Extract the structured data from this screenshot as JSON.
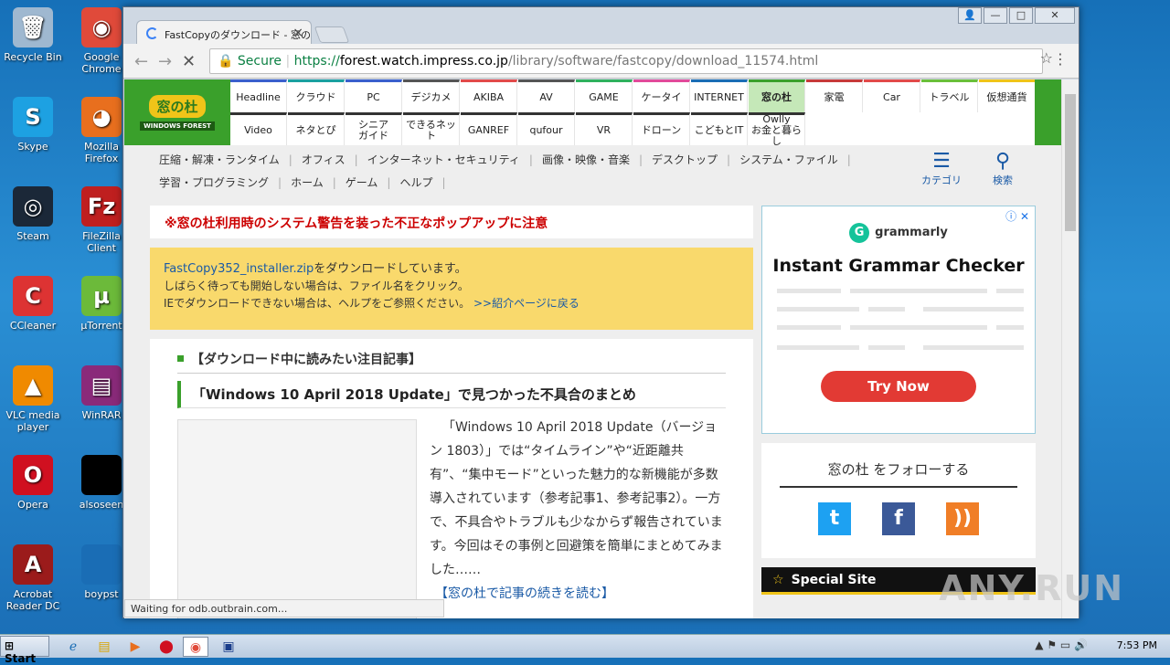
{
  "desktop": {
    "icons": [
      {
        "label": "Recycle Bin",
        "glyph": "🗑",
        "color": "#9fb8d0"
      },
      {
        "label": "Google Chrome",
        "glyph": "◉",
        "color": "#e04a3a"
      },
      {
        "label": "Skype",
        "glyph": "S",
        "color": "#1da1e2"
      },
      {
        "label": "Mozilla Firefox",
        "glyph": "◕",
        "color": "#e86f1e"
      },
      {
        "label": "Steam",
        "glyph": "◎",
        "color": "#1b2838"
      },
      {
        "label": "FileZilla Client",
        "glyph": "Fz",
        "color": "#bf1f1f"
      },
      {
        "label": "CCleaner",
        "glyph": "C",
        "color": "#d33"
      },
      {
        "label": "µTorrent",
        "glyph": "µ",
        "color": "#6cba3a"
      },
      {
        "label": "VLC media player",
        "glyph": "▲",
        "color": "#f08a00"
      },
      {
        "label": "WinRAR",
        "glyph": "▤",
        "color": "#8a2a7a"
      },
      {
        "label": "Opera",
        "glyph": "O",
        "color": "#d01020"
      },
      {
        "label": "alsoseen",
        "glyph": "",
        "color": "#000000"
      },
      {
        "label": "Acrobat Reader DC",
        "glyph": "A",
        "color": "#9b1b1b"
      },
      {
        "label": "boypst",
        "glyph": "",
        "color": "#1a6db5"
      }
    ]
  },
  "browser": {
    "tab_title": "FastCopyのダウンロード - 窓の",
    "url_secure": "Secure",
    "url_scheme": "https://",
    "url_domain": "forest.watch.impress.co.jp",
    "url_path": "/library/software/fastcopy/download_11574.html",
    "status": "Waiting for odb.outbrain.com..."
  },
  "site": {
    "logo_main": "窓の杜",
    "logo_sub": "WINDOWS FOREST",
    "nav_row1": [
      "Headline",
      "クラウド",
      "PC",
      "デジカメ",
      "AKIBA",
      "AV",
      "GAME",
      "ケータイ",
      "INTERNET",
      "窓の杜",
      "家電",
      "Car",
      "トラベル",
      "仮想通貨"
    ],
    "nav_row2": [
      "Video",
      "ネタとぴ",
      "シニア\nガイド",
      "できるネット",
      "GANREF",
      "qufour",
      "VR",
      "ドローン",
      "こどもとIT",
      "Owlly\nお金と暮らし"
    ],
    "nav_row1_colors": [
      "#3a5fcd",
      "#1aa0a0",
      "#3a5fcd",
      "#555555",
      "#e24a4a",
      "#555555",
      "#2fb15e",
      "#e24a9a",
      "#1a6db5",
      "#3aa02b",
      "#c73a3a",
      "#e24a4a",
      "#6abf3a",
      "#f0c419"
    ],
    "subnav_row1": [
      "圧縮・解凍・ランタイム",
      "オフィス",
      "インターネット・セキュリティ",
      "画像・映像・音楽",
      "デスクトップ",
      "システム・ファイル"
    ],
    "subnav_row2": [
      "学習・プログラミング",
      "ホーム",
      "ゲーム",
      "ヘルプ"
    ],
    "category_label": "カテゴリ",
    "search_label": "検索"
  },
  "warning": "※窓の杜利用時のシステム警告を装った不正なポップアップに注意",
  "download": {
    "filename": "FastCopy352_installer.zip",
    "line1_suffix": "をダウンロードしています。",
    "line2": "しばらく待っても開始しない場合は、ファイル名をクリック。",
    "line3": "IEでダウンロードできない場合は、ヘルプをご参照ください。",
    "back_link": ">>紹介ページに戻る"
  },
  "article": {
    "section": "【ダウンロード中に読みたい注目記事】",
    "title": "「Windows 10 April 2018 Update」で見つかった不具合のまとめ",
    "body": "「Windows 10 April 2018 Update（バージョン 1803）」では“タイムライン”や“近距離共有”、“集中モード”といった魅力的な新機能が多数導入されています（参考記事1、参考記事2）。一方で、不具合やトラブルも少なからず報告されています。今回はその事例と回避策を簡単にまとめてみました……",
    "readmore": "【窓の杜で記事の続きを読む】"
  },
  "ad": {
    "brand": "grammarly",
    "headline": "Instant Grammar Checker",
    "cta": "Try Now"
  },
  "follow": {
    "title": "窓の杜 をフォローする"
  },
  "special": "Special Site",
  "taskbar": {
    "start": "Start",
    "time": "7:53 PM"
  },
  "watermark": "ANY.RUN"
}
